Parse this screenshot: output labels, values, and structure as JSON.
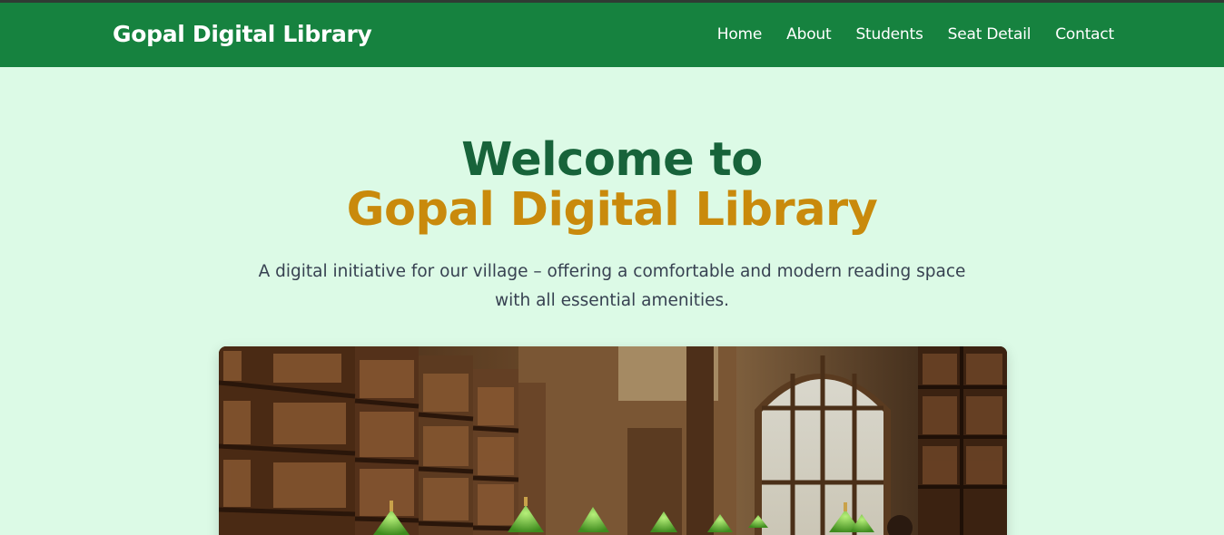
{
  "navbar": {
    "brand": "Gopal Digital Library",
    "links": [
      "Home",
      "About",
      "Students",
      "Seat Detail",
      "Contact"
    ]
  },
  "hero": {
    "title_line1": "Welcome to",
    "title_line2": "Gopal Digital Library",
    "subtitle_line1": "A digital initiative for our village – offering a comfortable and modern reading space",
    "subtitle_line2": "with all essential amenities."
  },
  "colors": {
    "nav_bg": "#16823f",
    "page_bg": "#dcfae6",
    "title_green": "#17633a",
    "title_gold": "#c98a0c"
  }
}
